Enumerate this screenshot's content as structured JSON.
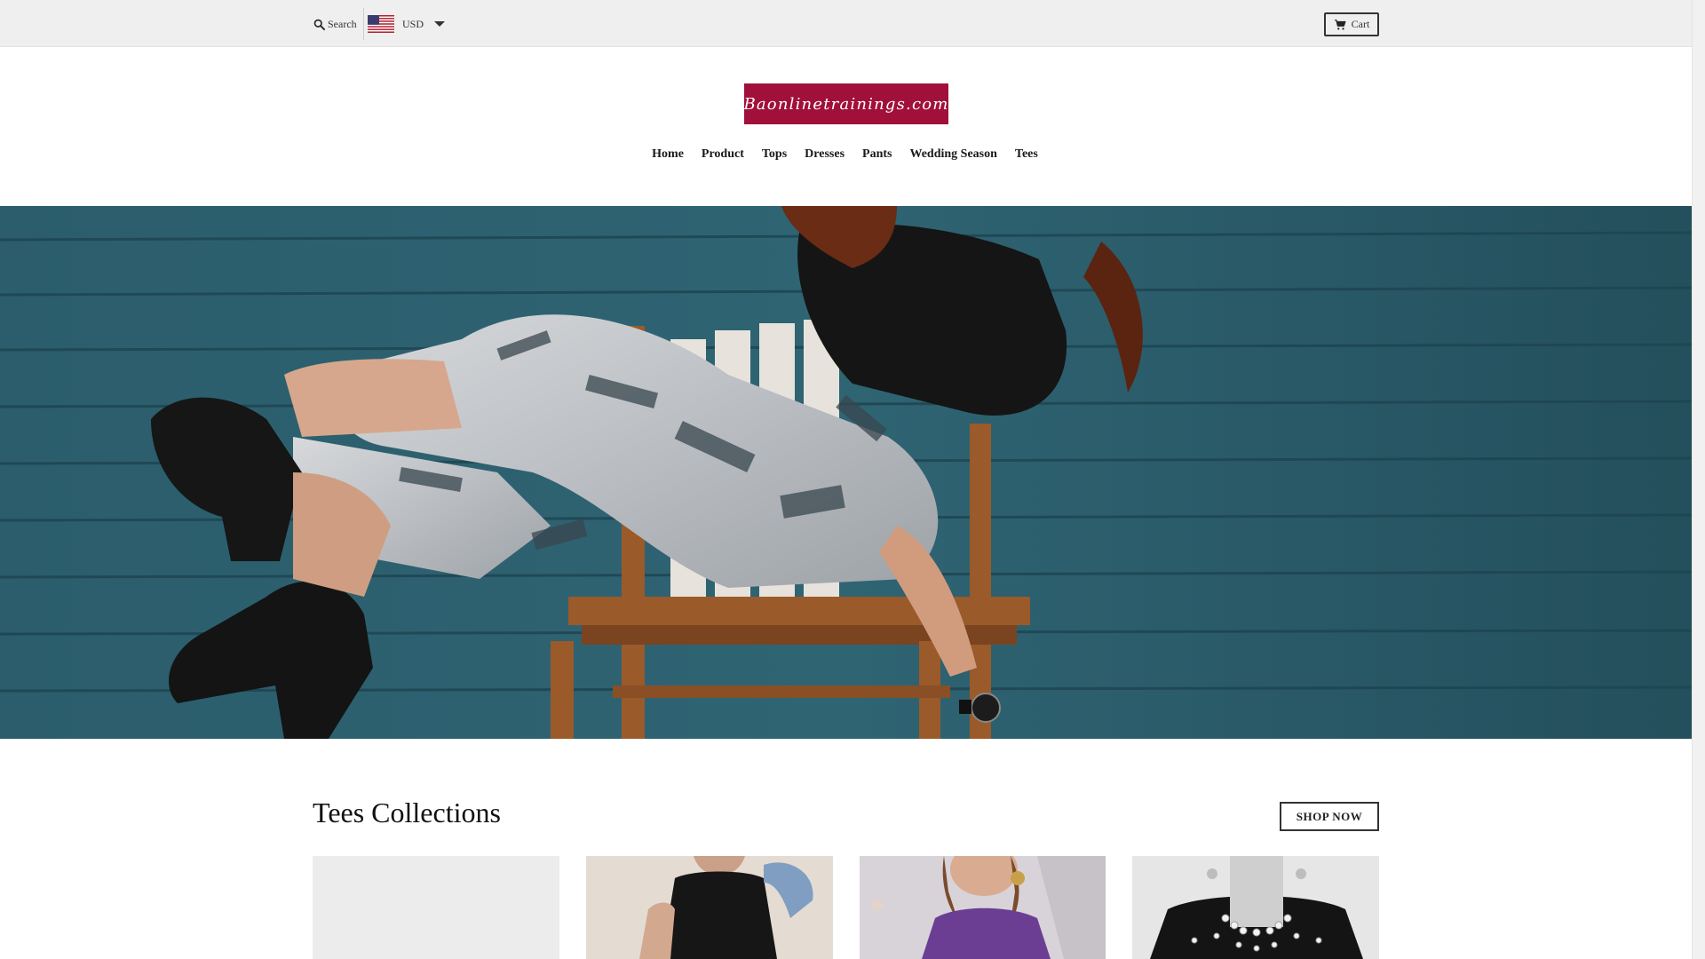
{
  "topbar": {
    "search_label": "Search",
    "currency_code": "USD",
    "cart_label": "Cart"
  },
  "header": {
    "logo_text": "Baonlinetrainings.com",
    "brand_color": "#a0103a"
  },
  "nav": {
    "items": [
      "Home",
      "Product",
      "Tops",
      "Dresses",
      "Pants",
      "Wedding Season",
      "Tees"
    ]
  },
  "collection": {
    "title": "Tees Collections",
    "shop_now_label": "SHOP NOW"
  },
  "icons": {
    "search": "search-icon",
    "flag": "us-flag-icon",
    "dropdown": "chevron-down-icon",
    "cart": "cart-icon"
  }
}
